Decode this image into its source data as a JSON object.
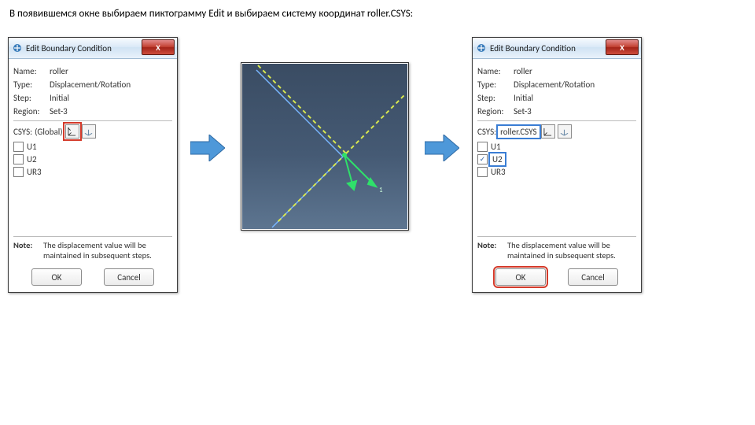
{
  "instruction": "В появившемся окне выбираем пиктограмму Edit и выбираем систему координат roller.CSYS:",
  "dialog": {
    "title": "Edit Boundary Condition",
    "close": "X",
    "name_label": "Name:",
    "type_label": "Type:",
    "step_label": "Step:",
    "region_label": "Region:",
    "csys_label": "CSYS:",
    "note_label": "Note:",
    "note_text": "The displacement value will be maintained in subsequent steps.",
    "ok": "OK",
    "cancel": "Cancel",
    "dof": {
      "u1": "U1",
      "u2": "U2",
      "ur3": "UR3"
    }
  },
  "left": {
    "name": "roller",
    "type": "Displacement/Rotation",
    "step": "Initial",
    "region": "Set-3",
    "csys": "(Global)",
    "u2_checked": false
  },
  "right": {
    "name": "roller",
    "type": "Displacement/Rotation",
    "step": "Initial",
    "region": "Set-3",
    "csys": "roller.CSYS",
    "u2_checked": true
  }
}
